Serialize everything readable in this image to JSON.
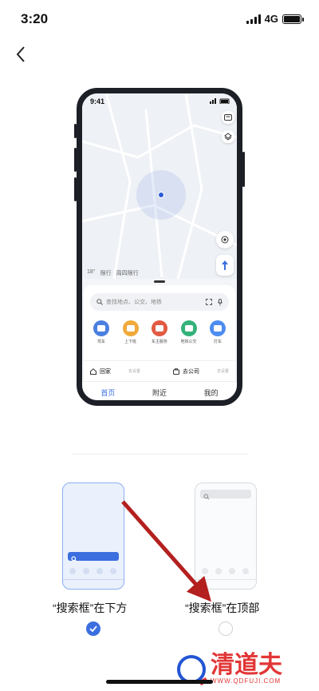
{
  "status_bar": {
    "time": "3:20",
    "network": "4G"
  },
  "preview": {
    "inner_time": "9:41",
    "weather_temp": "18°",
    "weather_traffic": "限行",
    "weather_extra": "周四限行",
    "search_placeholder": "查找地点、公交、地铁",
    "services": [
      {
        "label": "驾车",
        "color": "#4a7fe0"
      },
      {
        "label": "上下班",
        "color": "#f0a93a"
      },
      {
        "label": "车主服务",
        "color": "#e25a43"
      },
      {
        "label": "地铁公交",
        "color": "#35b27a"
      },
      {
        "label": "打车",
        "color": "#4d8cf0"
      }
    ],
    "home_label": "回家",
    "home_hint": "去设置",
    "work_label": "去公司",
    "work_hint": "去设置",
    "tabs": [
      "首页",
      "附近",
      "我的"
    ],
    "active_tab": 0
  },
  "options": {
    "bottom": {
      "label": "“搜索框”在下方",
      "selected": true
    },
    "top": {
      "label": "“搜索框”在顶部",
      "selected": false
    }
  },
  "watermark": {
    "text": "清道夫",
    "url": "WWW.QDFUJI.COM"
  },
  "colors": {
    "accent": "#3b6fe0",
    "arrow": "#b3201f"
  }
}
